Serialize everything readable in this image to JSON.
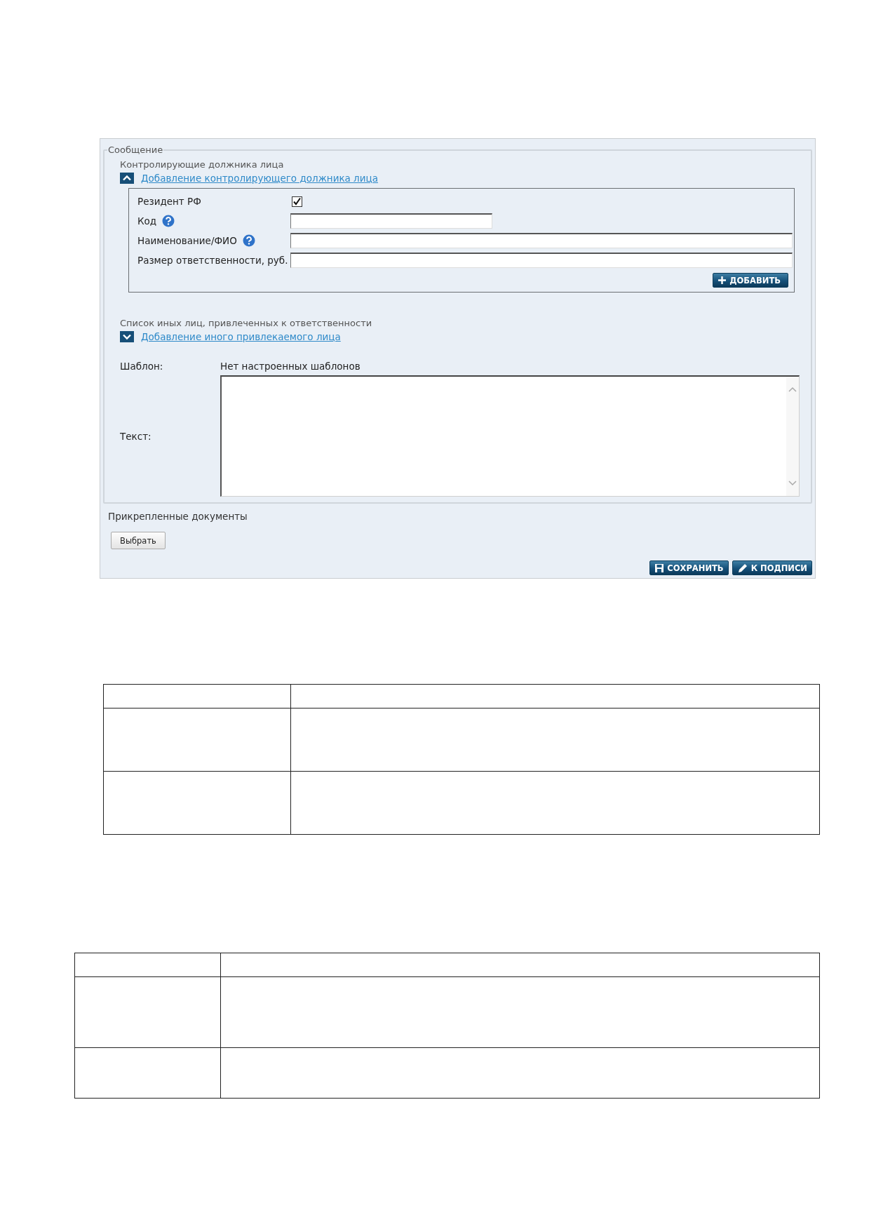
{
  "panel": {
    "legend": "Сообщение",
    "sections": [
      {
        "title": "Контролирующие должника лица",
        "toggle_label": "Добавление контролирующего должника лица",
        "expanded": true,
        "fields": [
          {
            "kind": "checkbox",
            "label": "Резидент РФ",
            "help": false,
            "checked": true
          },
          {
            "kind": "short-input",
            "label": "Код",
            "help": true
          },
          {
            "kind": "input",
            "label": "Наименование/ФИО",
            "help": true
          },
          {
            "kind": "input",
            "label": "Размер ответственности, руб.",
            "help": false
          }
        ],
        "add_button": "ДОБАВИТЬ"
      },
      {
        "title": "Список иных лиц, привлеченных к ответственности",
        "toggle_label": "Добавление иного привлекаемого лица",
        "expanded": false
      }
    ],
    "template": {
      "label": "Шаблон:",
      "value": "Нет настроенных шаблонов"
    },
    "text": {
      "label": "Текст:"
    },
    "attachments": {
      "title": "Прикрепленные документы",
      "button": "Выбрать"
    },
    "actions": [
      {
        "kind": "save",
        "label": "СОХРАНИТЬ"
      },
      {
        "kind": "sign",
        "label": "К ПОДПИСИ"
      }
    ]
  },
  "tables": [
    {
      "kind": "indented",
      "rows": [
        {
          "kind": "header"
        },
        {
          "kind": "tall"
        },
        {
          "kind": "tall"
        }
      ]
    },
    {
      "kind": "wide",
      "rows": [
        {
          "kind": "header"
        },
        {
          "kind": "taller"
        },
        {
          "kind": "medium"
        }
      ]
    }
  ]
}
